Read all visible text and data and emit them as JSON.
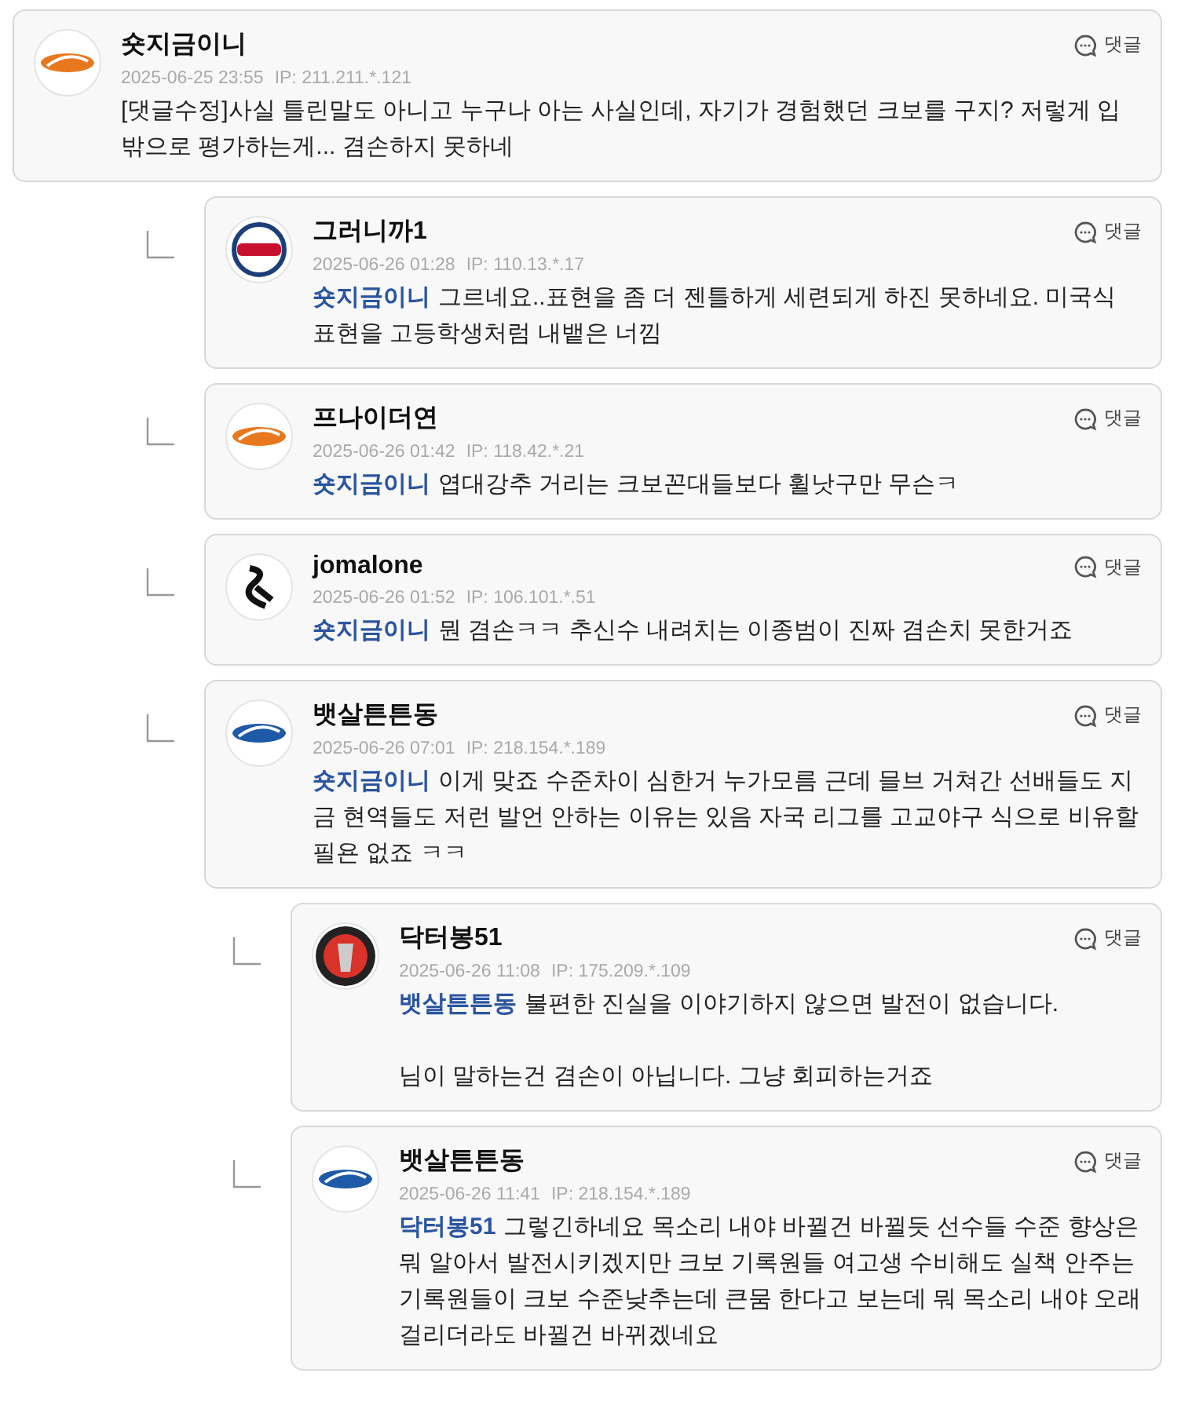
{
  "comments": [
    {
      "author": "숏지금이니",
      "date": "2025-06-25 23:55",
      "ip": "IP: 211.211.*.121",
      "text": "[댓글수정]사실 틀린말도 아니고 누구나 아는 사실인데, 자기가 경험했던 크보를 구지? 저렇게 입밖으로 평가하는게... 겸손하지 못하네",
      "reply_label": "댓글",
      "avatar": {
        "kind": "script",
        "color": "#e8781e"
      },
      "children": [
        {
          "author": "그러니까1",
          "date": "2025-06-26 01:28",
          "ip": "IP: 110.13.*.17",
          "mention": "숏지금이니",
          "text": "그르네요..표현을 좀 더 젠틀하게 세련되게 하진 못하네요. 미국식 표현을 고등학생처럼 내뱉은 너낌",
          "reply_label": "댓글",
          "avatar": {
            "kind": "badge",
            "color": "#c8102e"
          }
        },
        {
          "author": "프나이더연",
          "date": "2025-06-26 01:42",
          "ip": "IP: 118.42.*.21",
          "mention": "숏지금이니",
          "text": "엽대강추 거리는 크보꼰대들보다 휠낫구만 무슨ㅋ",
          "reply_label": "댓글",
          "avatar": {
            "kind": "script",
            "color": "#e8781e"
          }
        },
        {
          "author": "jomalone",
          "date": "2025-06-26 01:52",
          "ip": "IP: 106.101.*.51",
          "mention": "숏지금이니",
          "text": "뭔 겸손ㅋㅋ 추신수 내려치는 이종범이 진짜 겸손치 못한거죠",
          "reply_label": "댓글",
          "avatar": {
            "kind": "mono",
            "color": "#111111"
          }
        },
        {
          "author": "뱃살튼튼동",
          "date": "2025-06-26 07:01",
          "ip": "IP: 218.154.*.189",
          "mention": "숏지금이니",
          "text": "이게 맞죠 수준차이 심한거 누가모름 근데 믈브 거쳐간 선배들도 지금 현역들도 저런 발언 안하는 이유는 있음 자국 리그를 고교야구 식으로 비유할 필욘 없죠 ㅋㅋ",
          "reply_label": "댓글",
          "avatar": {
            "kind": "script",
            "color": "#1e5aa8"
          },
          "children": [
            {
              "author": "닥터봉51",
              "date": "2025-06-26 11:08",
              "ip": "IP: 175.209.*.109",
              "mention": "뱃살튼튼동",
              "text": "불편한 진실을 이야기하지 않으면 발전이 없습니다.\n\n님이 말하는건 겸손이 아닙니다. 그냥 회피하는거죠",
              "reply_label": "댓글",
              "avatar": {
                "kind": "dark",
                "color": "#d8322a"
              }
            },
            {
              "author": "뱃살튼튼동",
              "date": "2025-06-26 11:41",
              "ip": "IP: 218.154.*.189",
              "mention": "닥터봉51",
              "text": "그렇긴하네요 목소리 내야 바뀔건 바뀔듯 선수들 수준 향상은 뭐 알아서 발전시키겠지만 크보 기록원들 여고생 수비해도 실책 안주는 기록원들이 크보 수준낮추는데 큰뭄 한다고 보는데 뭐 목소리 내야 오래 걸리더라도 바뀔건 바뀌겠네요",
              "reply_label": "댓글",
              "avatar": {
                "kind": "script",
                "color": "#1e5aa8"
              }
            }
          ]
        }
      ]
    }
  ]
}
